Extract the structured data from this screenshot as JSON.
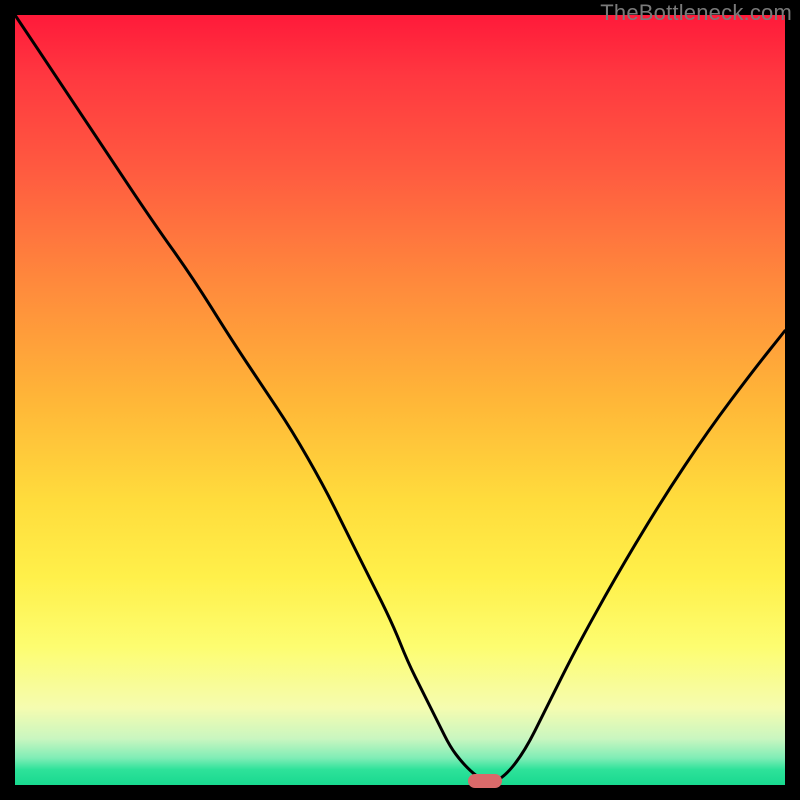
{
  "attribution": "TheBottleneck.com",
  "colors": {
    "frame": "#000000",
    "gradient_top": "#ff1a3a",
    "gradient_bottom": "#18d98f",
    "curve": "#000000",
    "marker": "#d96a6a",
    "attribution_text": "#7a7a7a"
  },
  "chart_data": {
    "type": "line",
    "title": "",
    "xlabel": "",
    "ylabel": "",
    "xlim": [
      0,
      100
    ],
    "ylim": [
      0,
      100
    ],
    "x": [
      0,
      6,
      12,
      18,
      23,
      28,
      32,
      36,
      40,
      43,
      46,
      49,
      51,
      53,
      55,
      56.5,
      58,
      59.5,
      61,
      63,
      66,
      69,
      73,
      78,
      84,
      90,
      96,
      100
    ],
    "values": [
      100,
      91,
      82,
      73,
      66,
      58,
      52,
      46,
      39,
      33,
      27,
      21,
      16,
      12,
      8,
      5,
      3,
      1.5,
      0.5,
      0.5,
      4,
      10,
      18,
      27,
      37,
      46,
      54,
      59
    ],
    "note": "Values estimated from pixel positions; y=0 at bottom (green). Single V-shaped curve with minimum around x≈60–62. Marker dot at approx (61, 0.5).",
    "marker": {
      "x": 61,
      "y": 0.5
    }
  }
}
